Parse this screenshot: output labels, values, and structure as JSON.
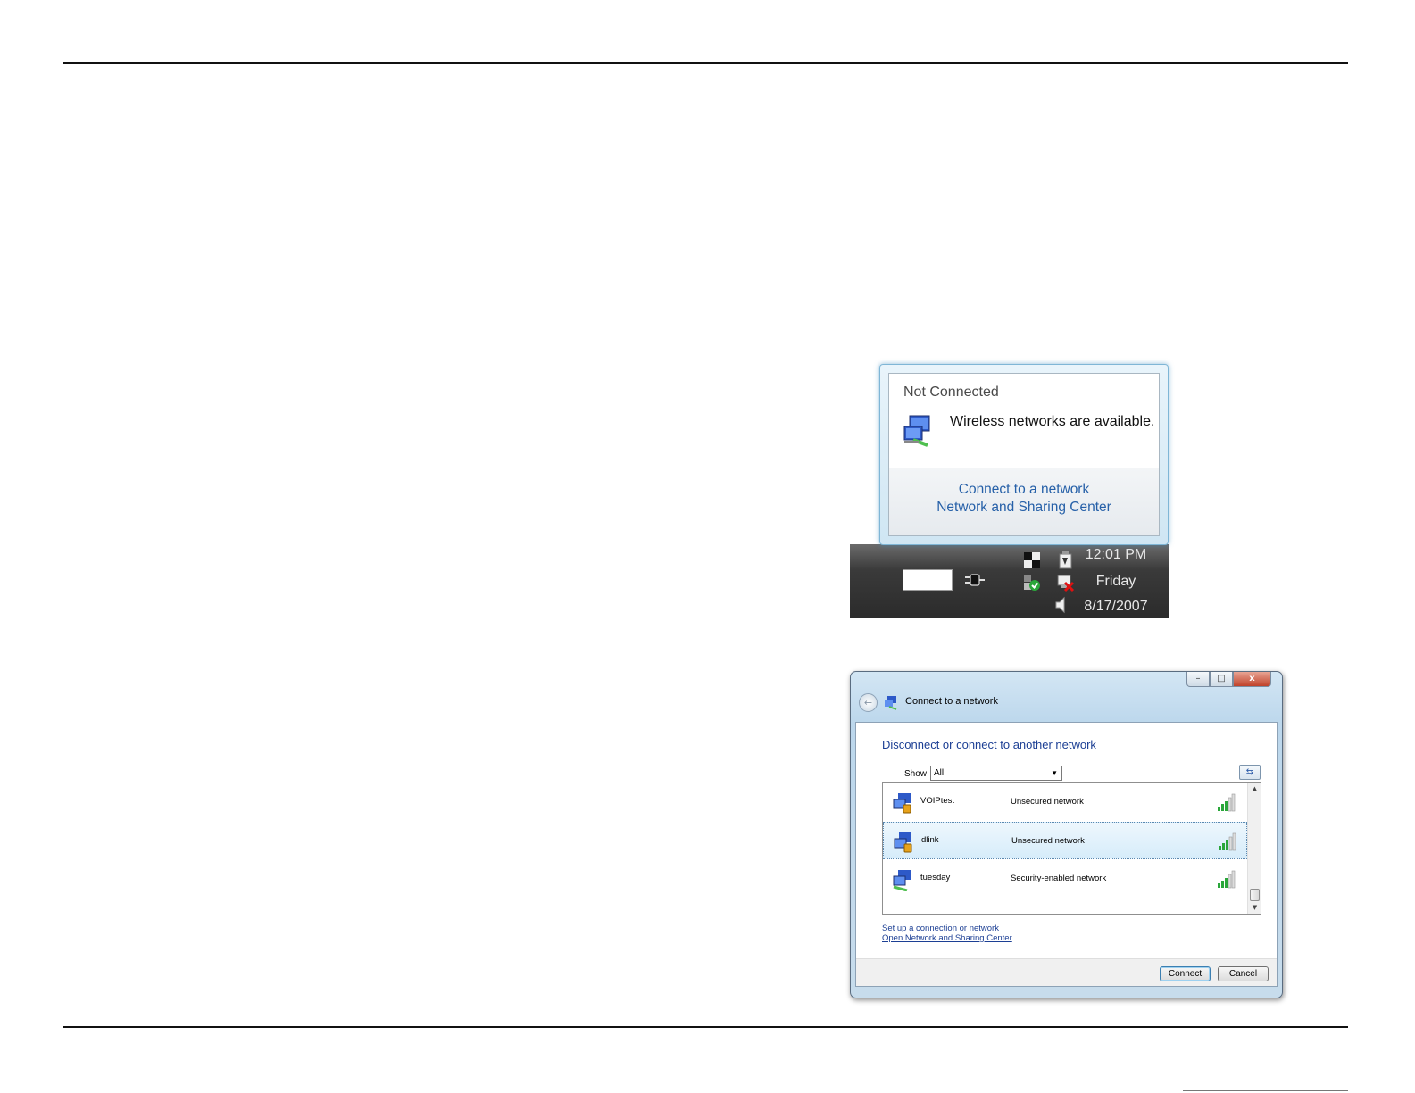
{
  "popup": {
    "title": "Not Connected",
    "message": "Wireless networks are available.",
    "links": [
      "Connect to a network",
      "Network and Sharing Center"
    ]
  },
  "taskbar": {
    "time": "12:01 PM",
    "day": "Friday",
    "date": "8/17/2007"
  },
  "window": {
    "title": "Connect to a network",
    "controls": [
      "–",
      "□",
      "x"
    ],
    "back_glyph": "←",
    "heading": "Disconnect or connect to another network",
    "show_label": "Show",
    "show_value": "All",
    "refresh_glyph": "⇆",
    "networks": [
      {
        "name": "VOIPtest",
        "security": "Unsecured network",
        "selected": false
      },
      {
        "name": "dlink",
        "security": "Unsecured network",
        "selected": true
      },
      {
        "name": "tuesday",
        "security": "Security-enabled network",
        "selected": false
      }
    ],
    "links": [
      "Set up a connection or network",
      "Open Network and Sharing Center"
    ],
    "buttons": {
      "connect": "Connect",
      "cancel": "Cancel"
    }
  },
  "colors": {
    "link_blue": "#2660a8",
    "heading_blue": "#1c3f94",
    "taskbar": "#2b2b2b",
    "signal_green": "#2aa63a"
  },
  "icons": [
    "wireless-network-icon",
    "power-plug-icon",
    "tray-network-icon",
    "tray-security-icon",
    "tray-disconnected-icon",
    "speaker-icon",
    "signal-strength-icon",
    "refresh-icon",
    "back-arrow-icon"
  ]
}
